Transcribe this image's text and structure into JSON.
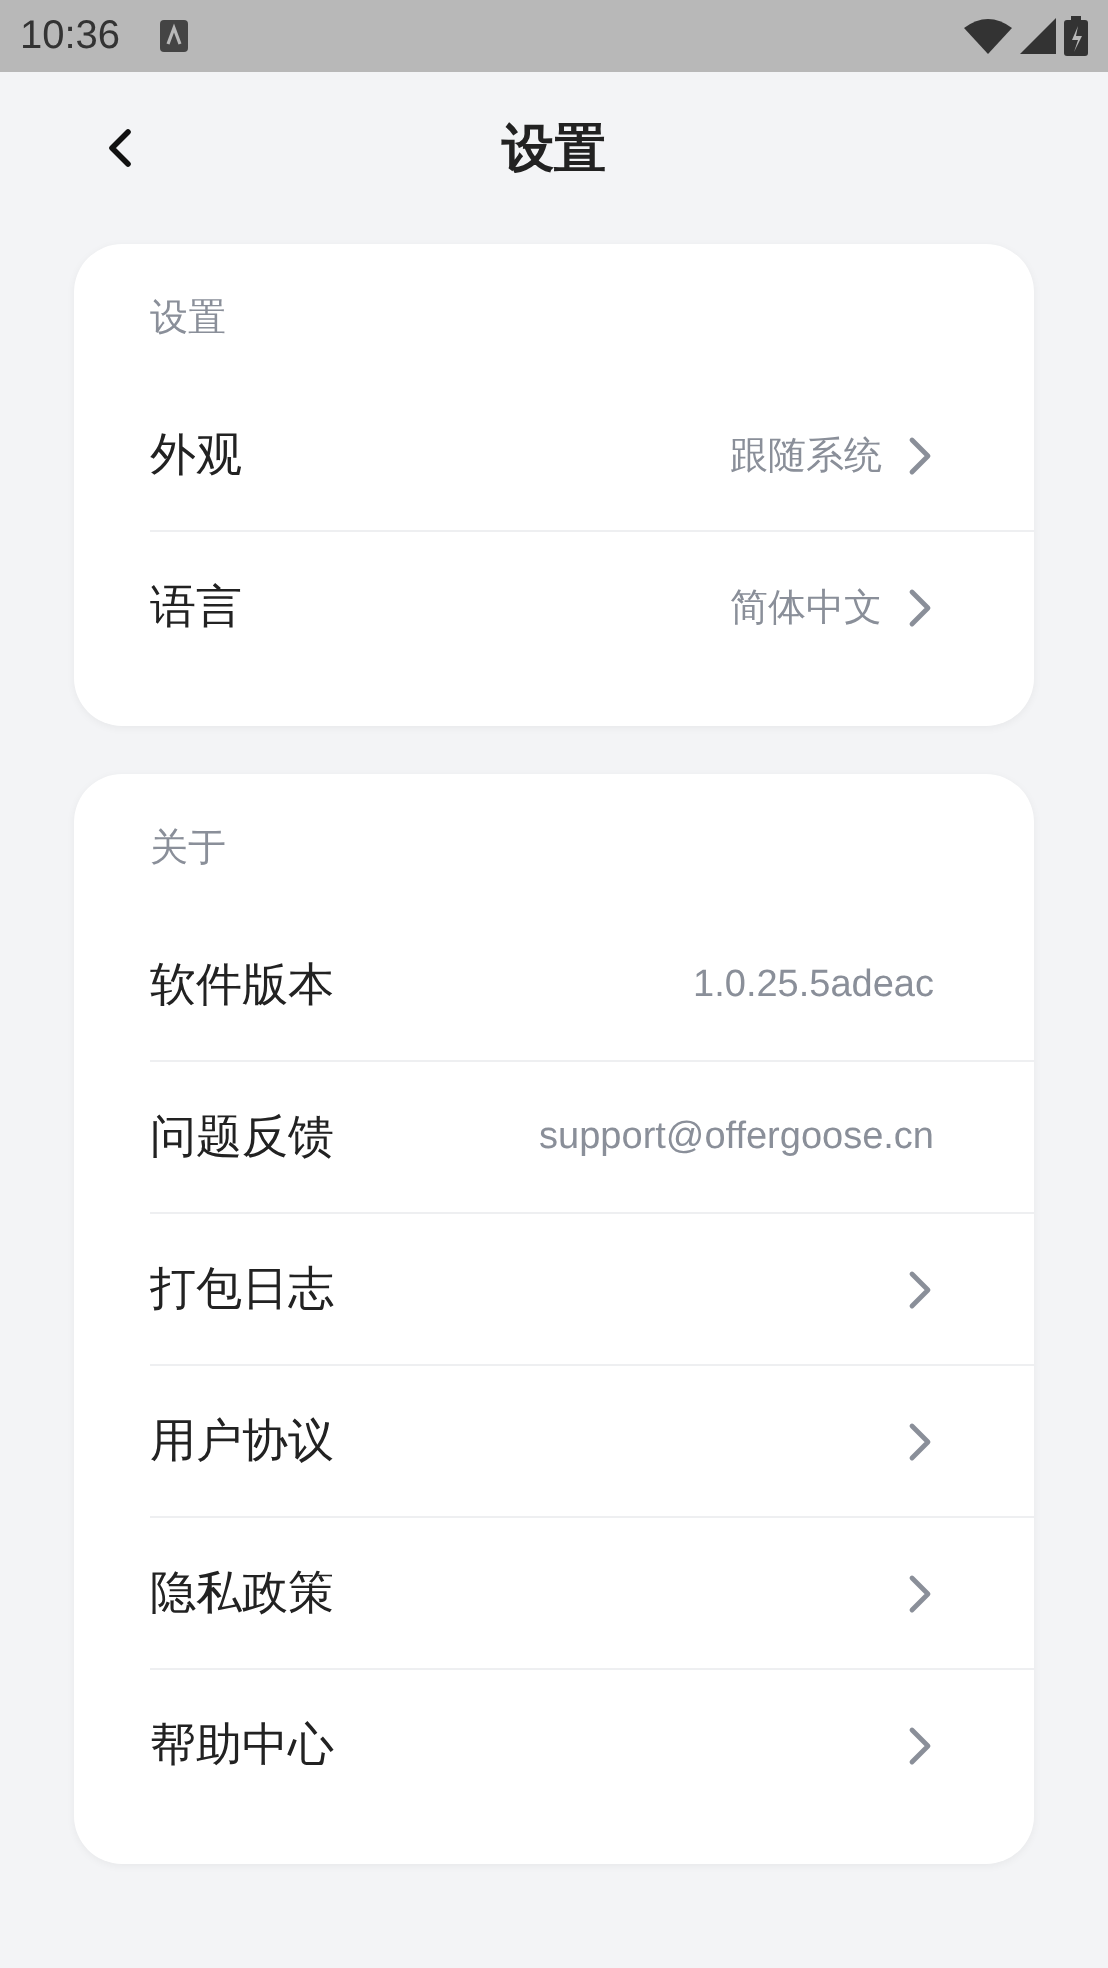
{
  "status_bar": {
    "time": "10:36"
  },
  "header": {
    "title": "设置"
  },
  "sections": [
    {
      "title": "设置",
      "rows": [
        {
          "label": "外观",
          "value": "跟随系统",
          "kind": "link"
        },
        {
          "label": "语言",
          "value": "简体中文",
          "kind": "link"
        }
      ]
    },
    {
      "title": "关于",
      "rows": [
        {
          "label": "软件版本",
          "value": "1.0.25.5adeac",
          "kind": "info"
        },
        {
          "label": "问题反馈",
          "value": "support@offergoose.cn",
          "kind": "info"
        },
        {
          "label": "打包日志",
          "kind": "link"
        },
        {
          "label": "用户协议",
          "kind": "link"
        },
        {
          "label": "隐私政策",
          "kind": "link"
        },
        {
          "label": "帮助中心",
          "kind": "link"
        }
      ]
    }
  ]
}
